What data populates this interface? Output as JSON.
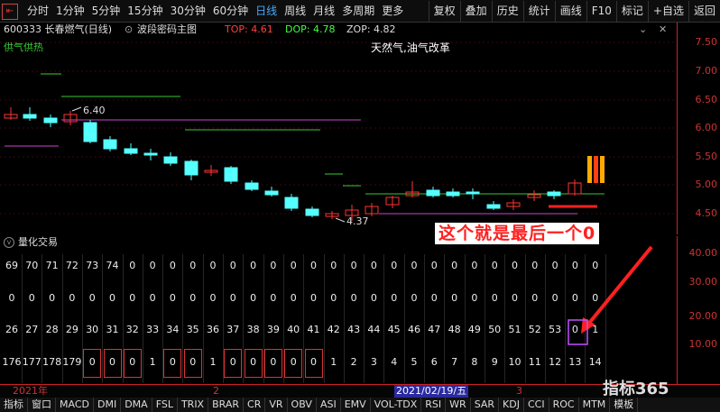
{
  "toolbar": {
    "back_label": "⇤",
    "periods": [
      "分时",
      "1分钟",
      "5分钟",
      "15分钟",
      "30分钟",
      "60分钟",
      "日线",
      "周线",
      "月线",
      "多周期",
      "更多"
    ],
    "active_period": "日线",
    "tools": [
      "复权",
      "叠加",
      "历史",
      "统计",
      "画线",
      "F10",
      "标记",
      "+自选",
      "返回"
    ]
  },
  "info": {
    "code_name": "600333 长春燃气(日线)",
    "indicator": "波段密码主图",
    "top": "TOP: 4.61",
    "dop": "DOP: 4.78",
    "zop": "ZOP: 4.82"
  },
  "main_chart": {
    "label_left": "供气供热",
    "label_center": "天然气,油气改革",
    "high_marker": "6.40",
    "low_marker": "4.37",
    "y_ticks": [
      "7.50",
      "7.00",
      "6.50",
      "6.00",
      "5.50",
      "5.00",
      "4.50"
    ],
    "colors": {
      "up": "#ff3333",
      "down": "#55ffff",
      "green": "#33cc33",
      "purple": "#cc44cc"
    }
  },
  "sub_chart": {
    "title": "量化交易",
    "y_ticks": [
      "40.00",
      "30.00",
      "20.00",
      "10.00"
    ],
    "row1": [
      "69",
      "70",
      "71",
      "72",
      "73",
      "74",
      "0",
      "0",
      "0",
      "0",
      "0",
      "0",
      "0",
      "0",
      "0",
      "0",
      "0",
      "0",
      "0",
      "0",
      "0",
      "0",
      "0",
      "0",
      "0",
      "0",
      "0",
      "0",
      "0",
      "0"
    ],
    "row2": [
      "0",
      "0",
      "0",
      "0",
      "0",
      "0",
      "0",
      "0",
      "0",
      "0",
      "0",
      "0",
      "0",
      "0",
      "0",
      "0",
      "0",
      "0",
      "0",
      "0",
      "0",
      "0",
      "0",
      "0",
      "0",
      "0",
      "0",
      "0",
      "0",
      "0"
    ],
    "row3": [
      "26",
      "27",
      "28",
      "29",
      "30",
      "31",
      "32",
      "33",
      "34",
      "35",
      "36",
      "37",
      "38",
      "39",
      "40",
      "41",
      "42",
      "43",
      "44",
      "45",
      "46",
      "47",
      "48",
      "49",
      "50",
      "51",
      "52",
      "53",
      "0",
      "1"
    ],
    "row4": [
      "176",
      "177",
      "178",
      "179",
      "0",
      "0",
      "0",
      "1",
      "0",
      "0",
      "1",
      "0",
      "0",
      "0",
      "0",
      "0",
      "1",
      "2",
      "3",
      "4",
      "5",
      "6",
      "7",
      "8",
      "9",
      "10",
      "11",
      "12",
      "13",
      "14"
    ]
  },
  "annotation": "这个就是最后一个0",
  "dates": {
    "year": "2021年",
    "month2": "2",
    "selected": "2021/02/19/五",
    "month3": "3"
  },
  "bottom_tabs": [
    "指标",
    "窗口",
    "MACD",
    "DMI",
    "DMA",
    "FSL",
    "TRIX",
    "BRAR",
    "CR",
    "VR",
    "OBV",
    "ASI",
    "EMV",
    "VOL-TDX",
    "RSI",
    "WR",
    "SAR",
    "KDJ",
    "CCI",
    "ROC",
    "MTM",
    "模板"
  ],
  "watermark": "指标365"
}
